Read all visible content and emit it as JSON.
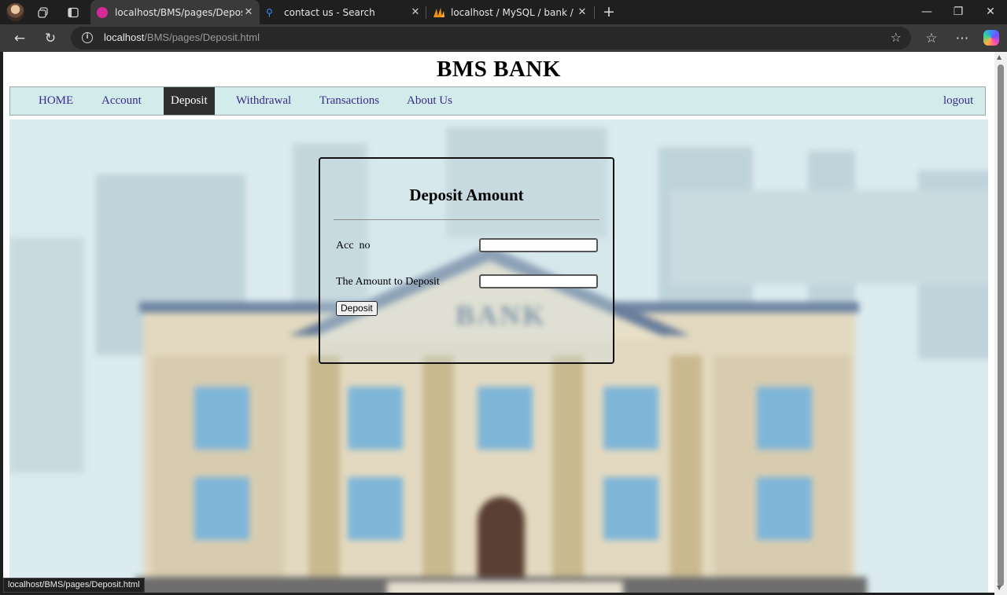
{
  "browser": {
    "tabs": [
      {
        "title": "localhost/BMS/pages/Deposit.html",
        "active": true,
        "favicon_color": "#d62a9b"
      },
      {
        "title": "contact us - Search",
        "active": false,
        "favicon_color": "#3a8bff"
      },
      {
        "title": "localhost / MySQL / bank / queries",
        "active": false,
        "favicon_color": "#f29111"
      }
    ],
    "new_tab_label": "+",
    "address": {
      "host": "localhost",
      "path": "/BMS/pages/Deposit.html"
    },
    "status_url": "localhost/BMS/pages/Deposit.html"
  },
  "site": {
    "title": "BMS BANK",
    "nav": [
      {
        "label": "HOME",
        "active": false
      },
      {
        "label": "Account",
        "active": false
      },
      {
        "label": "Deposit",
        "active": true
      },
      {
        "label": "Withdrawal",
        "active": false
      },
      {
        "label": "Transactions",
        "active": false
      },
      {
        "label": "About Us",
        "active": false
      }
    ],
    "logout_label": "logout",
    "scene_sign": "BANK"
  },
  "form": {
    "title": "Deposit Amount",
    "fields": [
      {
        "label": "Acc  no",
        "value": ""
      },
      {
        "label": "The Amount to Deposit",
        "value": ""
      }
    ],
    "submit_label": "Deposit"
  },
  "colors": {
    "navbar_bg": "#d2ecec",
    "nav_active_bg": "#2f2f2f",
    "nav_link": "#3a2a8a"
  }
}
